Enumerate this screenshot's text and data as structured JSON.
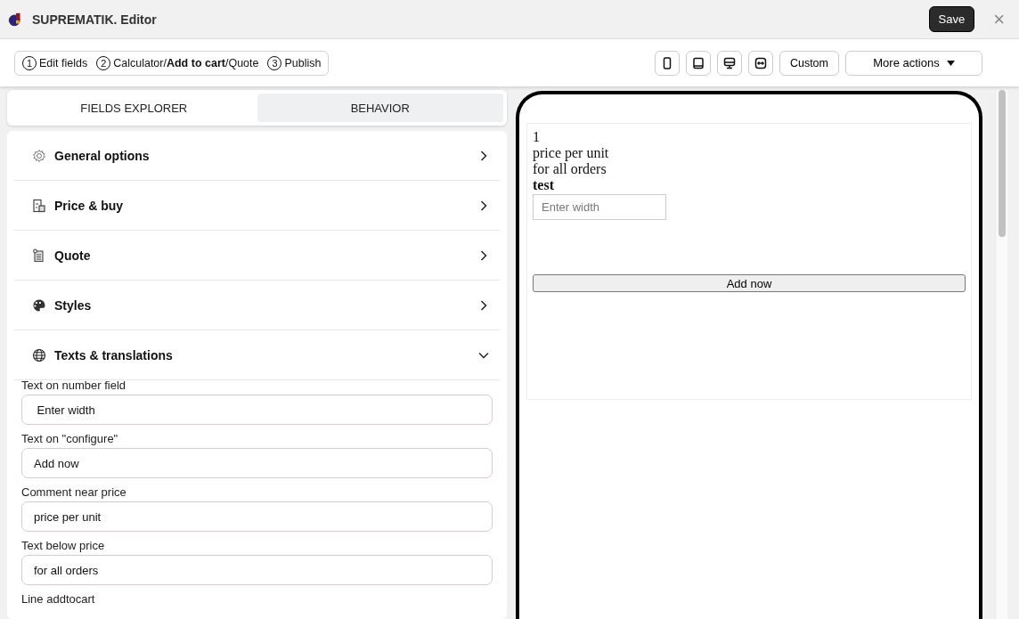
{
  "window": {
    "title": "SUPREMATIK. Editor",
    "save": "Save",
    "close": "×"
  },
  "steps": [
    {
      "number": "1",
      "label": "Edit fields"
    },
    {
      "number": "2",
      "label": "Calculator/**Add to cart**/Quote"
    },
    {
      "number": "3",
      "label": "Publish"
    }
  ],
  "toolbar": {
    "devices": [
      {
        "kind": "phone"
      },
      {
        "kind": "tablet"
      },
      {
        "kind": "desktop"
      },
      {
        "kind": "fit"
      }
    ],
    "custom": "Custom",
    "more": "More actions"
  },
  "tabs": [
    {
      "label": "FIELDS EXPLORER",
      "selected": false
    },
    {
      "label": "BEHAVIOR",
      "selected": true
    }
  ],
  "sections": [
    {
      "kind": "gear",
      "label": "General options",
      "expanded": false
    },
    {
      "kind": "price",
      "label": "Price & buy",
      "expanded": false
    },
    {
      "kind": "quote",
      "label": "Quote",
      "expanded": false
    },
    {
      "kind": "palette",
      "label": "Styles",
      "expanded": false
    },
    {
      "kind": "globe",
      "label": "Texts & translations",
      "expanded": true
    }
  ],
  "fields": [
    {
      "label": "Text on number field",
      "value": " Enter width"
    },
    {
      "label": "Text on \"configure\"",
      "value": "Add now"
    },
    {
      "label": "Comment near price",
      "value": "price per unit"
    },
    {
      "label": "Text below price",
      "value": "for all orders"
    },
    {
      "label": "Line addtocart"
    }
  ],
  "preview": {
    "price": "1",
    "comment": "price per unit",
    "below": "for all orders",
    "title": "test",
    "placeholder": "Enter width",
    "button": "Add now"
  }
}
